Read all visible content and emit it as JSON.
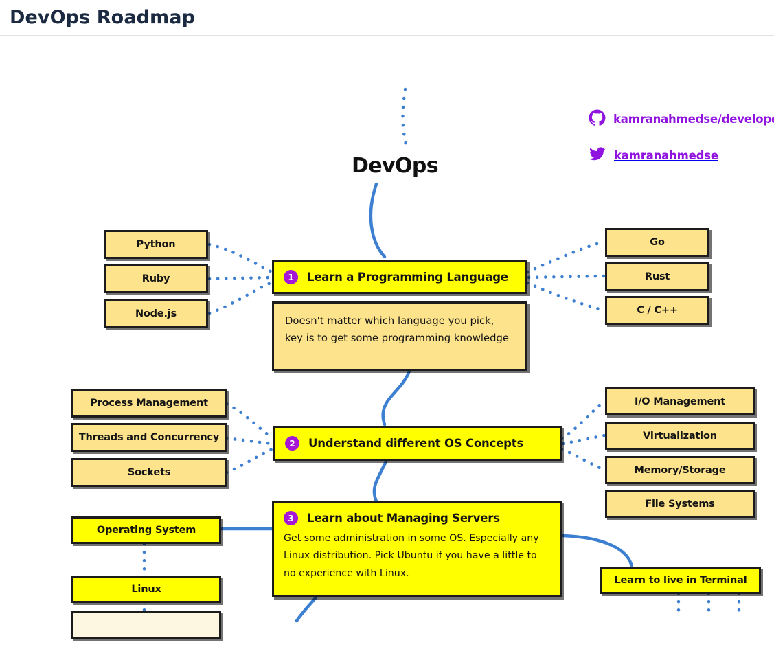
{
  "header": {
    "title": "DevOps Roadmap"
  },
  "social": {
    "github": {
      "icon": "github-icon",
      "label": "kamranahmedse/developer",
      "color": "#9013e0"
    },
    "twitter": {
      "icon": "twitter-icon",
      "label": "kamranahmedse",
      "color": "#9013e0"
    }
  },
  "root": {
    "title": "DevOps"
  },
  "colors": {
    "node_yellow": "#ffff00",
    "node_tan": "#fce38c",
    "badge_purple": "#a516d6",
    "edge_blue": "#3d7fd1",
    "border_black": "#1c1c1c",
    "title_navy": "#1b2a41"
  },
  "steps": [
    {
      "number": "1",
      "title": "Learn a Programming Language",
      "description": "Doesn't matter which language you pick, key is to get some programming knowledge",
      "left_children": [
        "Python",
        "Ruby",
        "Node.js"
      ],
      "right_children": [
        "Go",
        "Rust",
        "C / C++"
      ]
    },
    {
      "number": "2",
      "title": "Understand different OS Concepts",
      "left_children": [
        "Process Management",
        "Threads and Concurrency",
        "Sockets"
      ],
      "right_children": [
        "I/O Management",
        "Virtualization",
        "Memory/Storage",
        "File Systems"
      ]
    },
    {
      "number": "3",
      "title": "Learn about Managing Servers",
      "description": "Get some administration in some OS. Especially any Linux distribution. Pick Ubuntu if you have a little to no experience with Linux.",
      "left_children": [
        "Operating System",
        "Linux"
      ],
      "right_children": [
        "Learn to live in Terminal"
      ]
    }
  ]
}
